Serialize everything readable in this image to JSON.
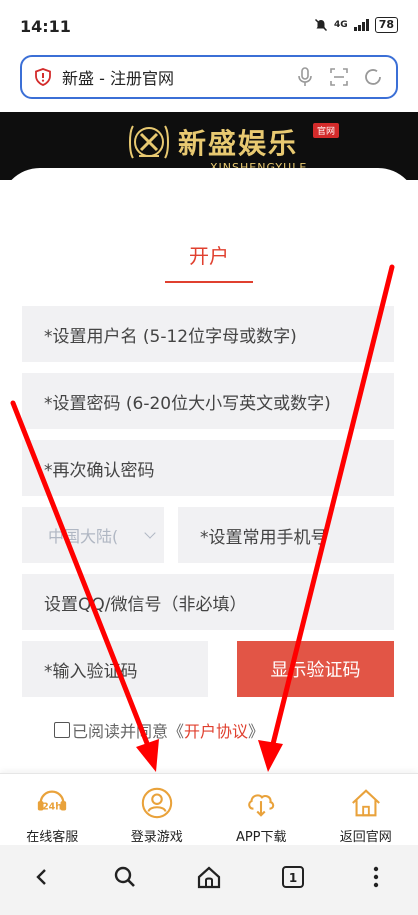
{
  "status_bar": {
    "time": "14:11",
    "network": "4G",
    "battery": "78"
  },
  "browser": {
    "url_title": "新盛 - 注册官网"
  },
  "header": {
    "logo_cn": "新盛娱乐",
    "logo_badge": "官网",
    "logo_en": "XINSHENGYULE"
  },
  "form": {
    "tab_title": "开户",
    "username_placeholder": "*设置用户名 (5-12位字母或数字)",
    "password_placeholder": "*设置密码 (6-20位大小写英文或数字)",
    "confirm_placeholder": "*再次确认密码",
    "region_selected": "中国大陆(",
    "phone_placeholder": "*设置常用手机号",
    "qq_placeholder": "设置QQ/微信号（非必填）",
    "captcha_placeholder": "*输入验证码",
    "captcha_button": "显示验证码",
    "agree_text": "已阅读并同意《",
    "agree_link": "开户协议",
    "agree_close": "》"
  },
  "bottom_nav": [
    {
      "label": "在线客服",
      "icon": "support-24h-icon"
    },
    {
      "label": "登录游戏",
      "icon": "user-icon"
    },
    {
      "label": "APP下载",
      "icon": "cloud-download-icon"
    },
    {
      "label": "返回官网",
      "icon": "home-icon"
    }
  ],
  "sys_nav": {
    "tabs_count": "1"
  },
  "colors": {
    "accent": "#e0402f",
    "button": "#e25546",
    "gold": "#e8c971",
    "url_border": "#3b6fd6",
    "arrow": "#ff0000"
  }
}
